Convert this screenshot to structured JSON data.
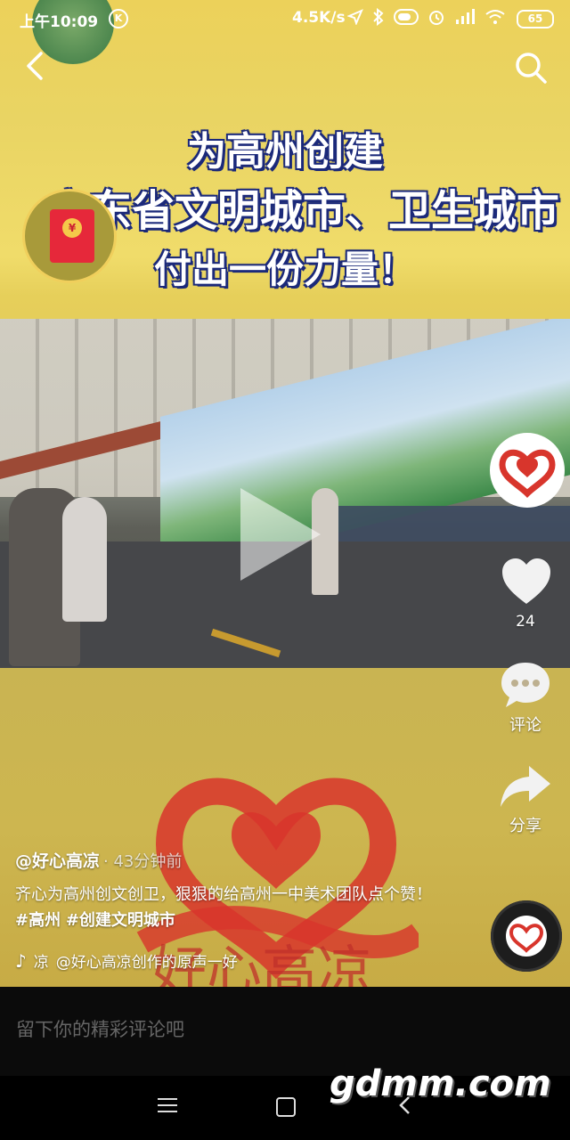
{
  "status_bar": {
    "time": "上午10:09",
    "k_badge": "K",
    "net_speed": "4.5K/s",
    "icons": [
      "location-icon",
      "bluetooth-icon",
      "toggle-icon",
      "alarm-icon",
      "signal-icon",
      "wifi-icon"
    ],
    "battery": "65"
  },
  "video": {
    "headline_line1": "为高州创建",
    "headline_line2": "广东省文明城市、卫生城市",
    "headline_line3": "付出一份力量！",
    "logo_text": "好心高凉"
  },
  "red_packet": {
    "symbol": "¥"
  },
  "side_actions": {
    "like_count": "24",
    "comment_label": "评论",
    "share_label": "分享"
  },
  "post": {
    "author": "@好心高凉",
    "time_ago": "· 43分钟前",
    "caption_text": "齐心为高州创文创卫，狠狠的给高州一中美术团队点个赞！",
    "tags": [
      "#高州",
      "#创建文明城市"
    ],
    "music_prefix": "凉",
    "music_track": "@好心高凉创作的原声一好"
  },
  "comment_bar": {
    "placeholder": "留下你的精彩评论吧"
  },
  "watermark": "gdmm.com",
  "colors": {
    "accent_red": "#e6283a",
    "headline_outline": "#1c2a7a",
    "bg_yellow": "#ecd15a"
  }
}
